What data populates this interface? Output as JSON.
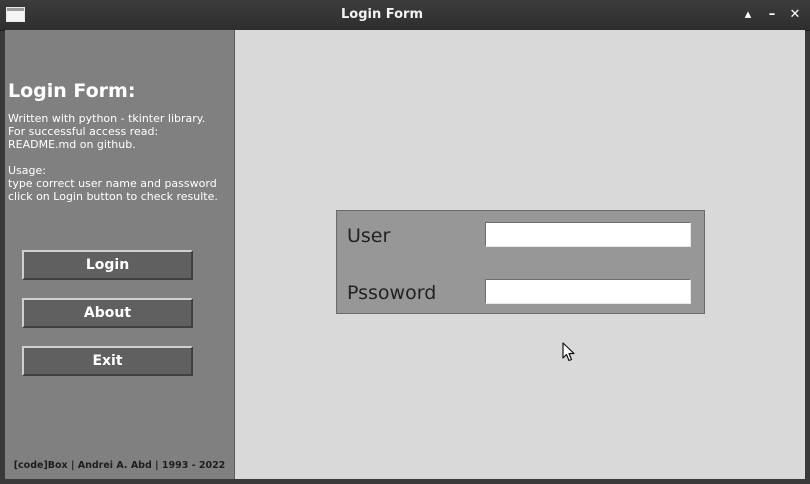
{
  "window": {
    "title": "Login Form",
    "controls": {
      "restore": "▴",
      "minimize": "–",
      "close": "✕"
    }
  },
  "sidebar": {
    "heading": "Login Form:",
    "description": [
      "Written with python - tkinter library.",
      "For successful access read:",
      "README.md on github.",
      "",
      "Usage:",
      "type correct user name and password",
      "click on Login button to check resulte."
    ],
    "buttons": {
      "login": "Login",
      "about": "About",
      "exit": "Exit"
    },
    "footer": "[code]Box | Andrei A. Abd | 1993 - 2022"
  },
  "form": {
    "user_label": "User",
    "user_value": "",
    "password_label": "Pssoword",
    "password_value": ""
  },
  "colors": {
    "sidebar_bg": "#808080",
    "content_bg": "#d9d9d9",
    "form_bg": "#979797",
    "button_bg": "#606060"
  }
}
